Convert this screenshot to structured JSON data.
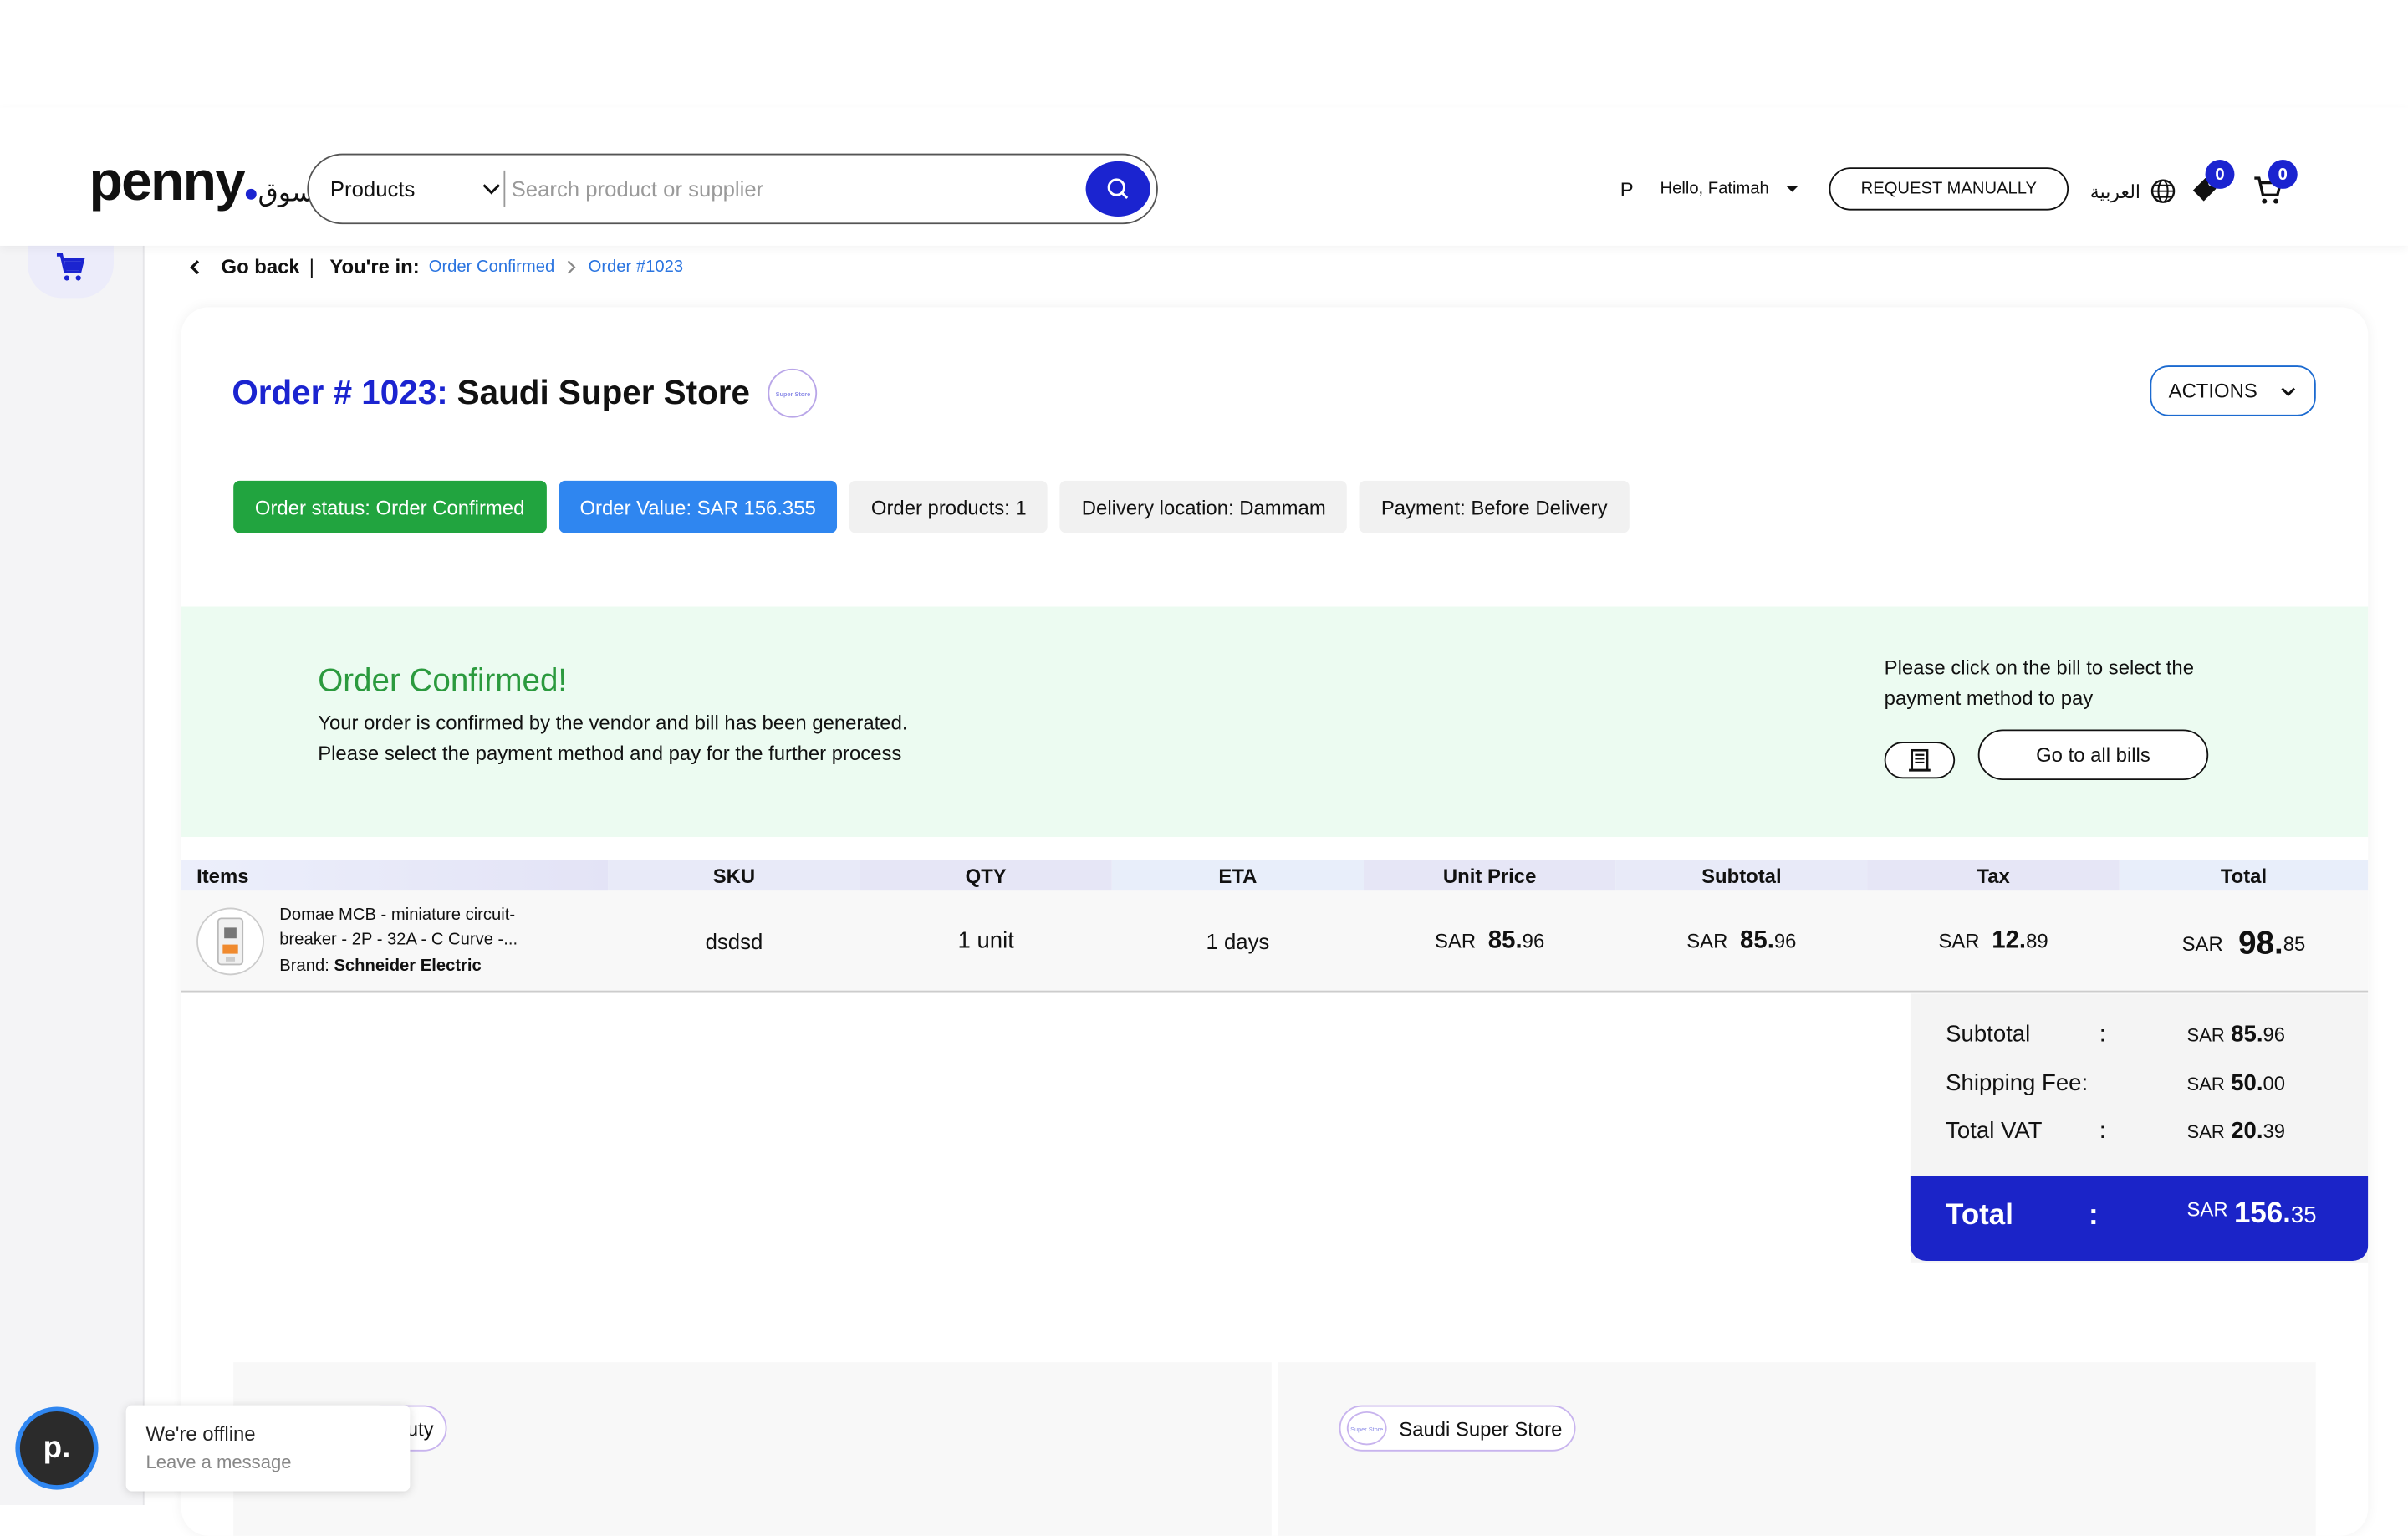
{
  "header": {
    "logo_text": "penny",
    "logo_arabic": "سوق",
    "search_category": "Products",
    "search_placeholder": "Search product or supplier",
    "user_initial": "P",
    "greeting": "Hello, Fatimah",
    "request_manually": "REQUEST MANUALLY",
    "language": "العربية",
    "wishlist_count": "0",
    "cart_count": "0"
  },
  "breadcrumb": {
    "back": "Go back",
    "separator": "|",
    "you_are_in": "You're in:",
    "crumbs": [
      "Order Confirmed",
      "Order #1023"
    ]
  },
  "order": {
    "number_label": "Order # 1023:",
    "store_name": "Saudi Super Store",
    "store_logo_text": "Super Store",
    "actions_label": "ACTIONS",
    "chips": {
      "status": "Order status: Order Confirmed",
      "value": "Order Value: SAR 156.355",
      "products": "Order products: 1",
      "location": "Delivery location: Dammam",
      "payment": "Payment: Before Delivery"
    }
  },
  "confirmation": {
    "title": "Order Confirmed!",
    "line1": "Your order is confirmed by the vendor and bill has been generated.",
    "line2": "Please select the payment method and pay for the further process",
    "bill_note": "Please click on the bill to select the payment method to pay",
    "bills_button": "Go to all bills"
  },
  "table": {
    "headers": [
      "Items",
      "SKU",
      "QTY",
      "ETA",
      "Unit Price",
      "Subtotal",
      "Tax",
      "Total"
    ],
    "row": {
      "name_line1": "Domae MCB - miniature circuit-",
      "name_line2": "breaker - 2P - 32A - C Curve -...",
      "brand_label": "Brand:",
      "brand": "Schneider Electric",
      "sku": "dsdsd",
      "qty": "1 unit",
      "eta": "1 days",
      "unit_price": {
        "cur": "SAR",
        "int": "85.",
        "dec": "96"
      },
      "subtotal": {
        "cur": "SAR",
        "int": "85.",
        "dec": "96"
      },
      "tax": {
        "cur": "SAR",
        "int": "12.",
        "dec": "89"
      },
      "total": {
        "cur": "SAR",
        "int": "98.",
        "dec": "85"
      }
    }
  },
  "summary": {
    "subtotal": {
      "label": "Subtotal",
      "colon": ":",
      "cur": "SAR",
      "int": "85.",
      "dec": "96"
    },
    "shipping": {
      "label": "Shipping Fee:",
      "colon": "",
      "cur": "SAR",
      "int": "50.",
      "dec": "00"
    },
    "vat": {
      "label": "Total VAT",
      "colon": ":",
      "cur": "SAR",
      "int": "20.",
      "dec": "39"
    },
    "total": {
      "label": "Total",
      "colon": ":",
      "cur": "SAR",
      "int": "156.",
      "dec": "35"
    }
  },
  "bottom": {
    "left_pill": "uty",
    "right_pill": "Saudi Super Store",
    "right_logo_text": "Super Store"
  },
  "chat": {
    "avatar": "p.",
    "status": "We're offline",
    "action": "Leave a message"
  },
  "colors": {
    "brand": "#1b24d0",
    "status_green": "#21a43f",
    "value_blue": "#2f86f0",
    "confirm_bg": "#ecfbf1"
  }
}
